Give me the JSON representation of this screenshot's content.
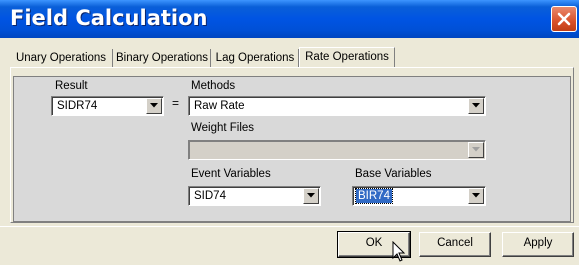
{
  "window": {
    "title": "Field Calculation"
  },
  "tabs": [
    {
      "label": "Unary Operations"
    },
    {
      "label": "Binary Operations"
    },
    {
      "label": "Lag Operations"
    },
    {
      "label": "Rate Operations"
    }
  ],
  "active_tab": "Rate Operations",
  "form": {
    "result_label": "Result",
    "result_value": "SIDR74",
    "equals": "=",
    "methods_label": "Methods",
    "methods_value": "Raw Rate",
    "weight_files_label": "Weight Files",
    "weight_files_value": "",
    "event_variables_label": "Event Variables",
    "event_variables_value": "SID74",
    "base_variables_label": "Base Variables",
    "base_variables_value": "BIR74"
  },
  "buttons": {
    "ok": "OK",
    "cancel": "Cancel",
    "apply": "Apply"
  },
  "icons": {
    "close": "close-icon",
    "dropdown": "chevron-down-icon",
    "cursor": "mouse-pointer-icon"
  },
  "colors": {
    "title_bar": "#0054e3",
    "close_button": "#d9502a",
    "selection": "#316ac5"
  }
}
